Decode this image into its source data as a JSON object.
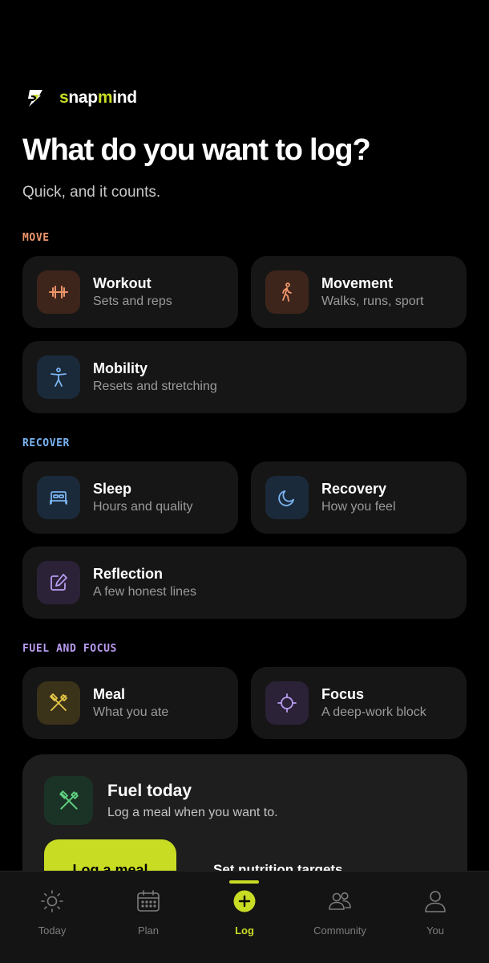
{
  "app": {
    "logo_prefix": "s",
    "logo_mid1": "nap",
    "logo_accent": "m",
    "logo_suffix": "ind"
  },
  "header": {
    "title": "What do you want to log?",
    "subtitle": "Quick, and it counts."
  },
  "sections": {
    "move": {
      "label": "MOVE",
      "color": "#f0966b"
    },
    "recover": {
      "label": "RECOVER",
      "color": "#7ab4f2"
    },
    "fuel": {
      "label": "FUEL AND FOCUS",
      "color": "#b89cf0"
    }
  },
  "cards": {
    "workout": {
      "title": "Workout",
      "subtitle": "Sets and reps",
      "icon": "dumbbell-icon"
    },
    "movement": {
      "title": "Movement",
      "subtitle": "Walks, runs, sport",
      "icon": "walking-icon"
    },
    "mobility": {
      "title": "Mobility",
      "subtitle": "Resets and stretching",
      "icon": "stretch-figure-icon"
    },
    "sleep": {
      "title": "Sleep",
      "subtitle": "Hours and quality",
      "icon": "bed-icon"
    },
    "recovery": {
      "title": "Recovery",
      "subtitle": "How you feel",
      "icon": "moon-icon"
    },
    "reflection": {
      "title": "Reflection",
      "subtitle": "A few honest lines",
      "icon": "edit-note-icon"
    },
    "meal": {
      "title": "Meal",
      "subtitle": "What you ate",
      "icon": "utensils-icon"
    },
    "focus": {
      "title": "Focus",
      "subtitle": "A deep-work block",
      "icon": "crosshair-icon"
    }
  },
  "promo": {
    "title": "Fuel today",
    "subtitle": "Log a meal when you want to.",
    "primary_label": "Log a meal",
    "secondary_label": "Set nutrition targets",
    "icon": "utensils-icon"
  },
  "tabs": [
    {
      "label": "Today",
      "icon": "sun-icon"
    },
    {
      "label": "Plan",
      "icon": "calendar-icon"
    },
    {
      "label": "Log",
      "icon": "plus-circle-icon"
    },
    {
      "label": "Community",
      "icon": "people-icon"
    },
    {
      "label": "You",
      "icon": "person-icon"
    }
  ],
  "colors": {
    "accent": "#c8dc24",
    "move_icon_bg": "#3d251b",
    "recover_icon_bg": "#1b2a3a",
    "reflect_icon_bg": "#2b2238",
    "meal_icon_bg": "#3a3219",
    "focus_icon_bg": "#2b2238"
  }
}
